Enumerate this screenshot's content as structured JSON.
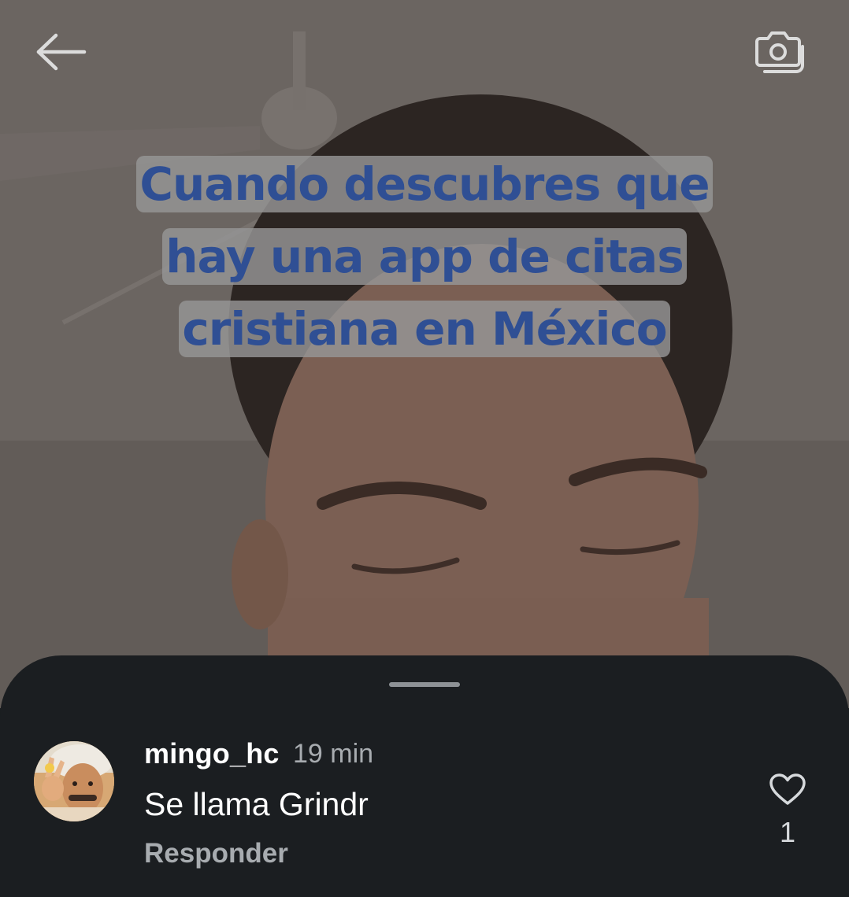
{
  "video": {
    "overlay_lines": [
      "Cuando descubres que",
      "hay una app de citas",
      "cristiana en México"
    ],
    "overlay_text_color": "#2f4f94",
    "overlay_bg_color": "#969696"
  },
  "toolbar": {
    "back_icon": "arrow-left-icon",
    "camera_icon": "camera-icon"
  },
  "comment": {
    "username": "mingo_hc",
    "time": "19 min",
    "text": "Se llama Grindr",
    "reply_label": "Responder",
    "like_count": "1",
    "like_icon": "heart-outline-icon"
  },
  "colors": {
    "sheet_bg": "#1b1e21",
    "secondary_text": "#a8acb0"
  }
}
